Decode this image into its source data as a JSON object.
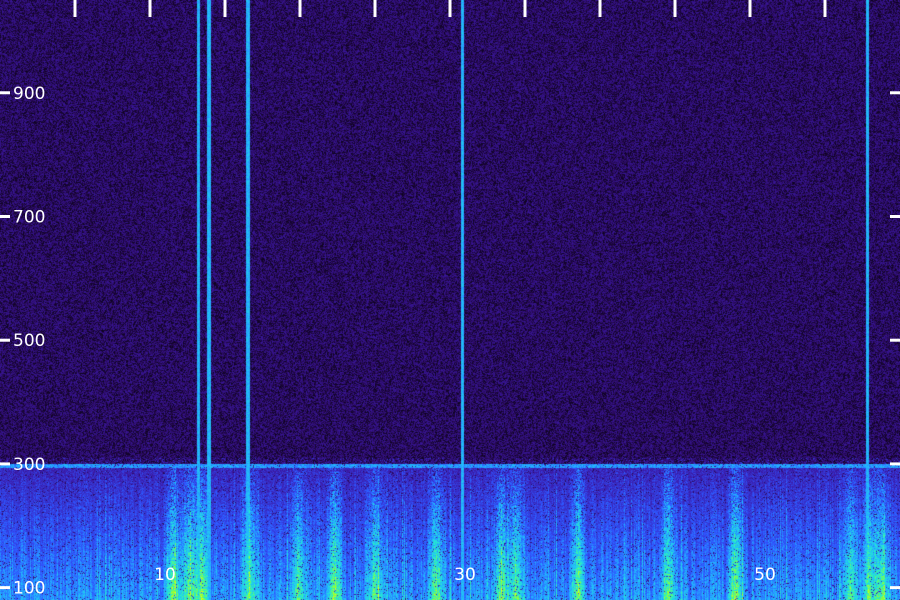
{
  "chart_data": {
    "type": "heatmap",
    "title": "",
    "xlabel": "",
    "ylabel": "",
    "x_range": [
      -1,
      59
    ],
    "y_range": [
      80,
      1050
    ],
    "x_ticks_major": [
      {
        "value": 10,
        "label": "10"
      },
      {
        "value": 30,
        "label": "30"
      },
      {
        "value": 50,
        "label": "50"
      }
    ],
    "x_ticks_minor": [
      4,
      9,
      14,
      19,
      24,
      29,
      34,
      39,
      44,
      49,
      54
    ],
    "y_ticks": [
      {
        "value": 100,
        "label": "100"
      },
      {
        "value": 300,
        "label": "300"
      },
      {
        "value": 500,
        "label": "500"
      },
      {
        "value": 700,
        "label": "700"
      },
      {
        "value": 900,
        "label": "900"
      }
    ],
    "grid": false,
    "colormap": [
      "#000000",
      "#2a0a5e",
      "#3b1aa8",
      "#2f55ff",
      "#22b8ff",
      "#26f0c8",
      "#8cff3a",
      "#ffff00"
    ],
    "background_level": 0.22,
    "band_cutoff": 300,
    "narrowband_lines_x": [
      12.2,
      12.9,
      15.5,
      29.8,
      56.8
    ],
    "broadband_bursts_x": [
      10.5,
      11.6,
      12.4,
      15.6,
      18.9,
      21.3,
      24.0,
      28.1,
      32.4,
      33.4,
      37.5,
      43.5,
      48.0,
      55.7,
      56.9,
      57.8
    ]
  }
}
